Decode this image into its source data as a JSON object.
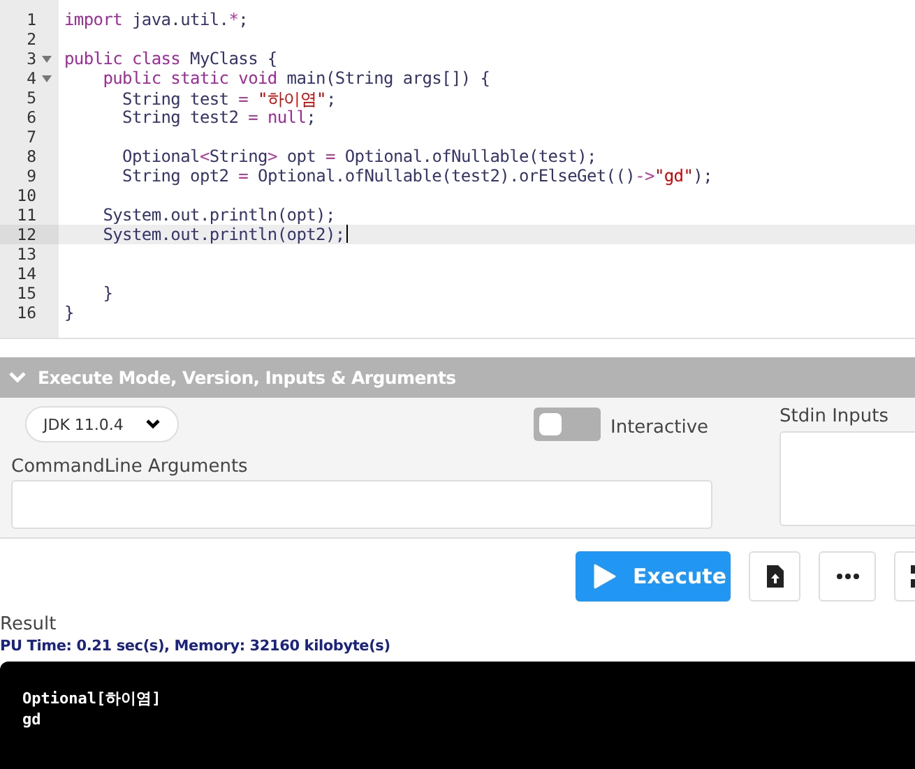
{
  "editor": {
    "lines": [
      {
        "number": "1",
        "foldable": false,
        "active": false,
        "tokens": [
          {
            "text": "import",
            "kind": "keyword"
          },
          {
            "text": " java.util.",
            "kind": "plain"
          },
          {
            "text": "*",
            "kind": "operator"
          },
          {
            "text": ";",
            "kind": "plain"
          }
        ]
      },
      {
        "number": "2",
        "foldable": false,
        "active": false
      },
      {
        "number": "3",
        "foldable": true,
        "active": false,
        "tokens": [
          {
            "text": "public class",
            "kind": "keyword"
          },
          {
            "text": " MyClass {",
            "kind": "plain"
          }
        ]
      },
      {
        "number": "4",
        "foldable": true,
        "active": false,
        "tokens": [
          {
            "text": "    public static void",
            "kind": "keyword"
          },
          {
            "text": " main(String args[]) {",
            "kind": "plain"
          }
        ]
      },
      {
        "number": "5",
        "foldable": false,
        "active": false,
        "tokens": [
          {
            "text": "      String test ",
            "kind": "plain"
          },
          {
            "text": "= ",
            "kind": "operator"
          },
          {
            "text": "\"하이염\"",
            "kind": "string"
          },
          {
            "text": ";",
            "kind": "plain"
          }
        ]
      },
      {
        "number": "6",
        "foldable": false,
        "active": false,
        "tokens": [
          {
            "text": "      String test2 ",
            "kind": "plain"
          },
          {
            "text": "= ",
            "kind": "operator"
          },
          {
            "text": "null",
            "kind": "keyword"
          },
          {
            "text": ";",
            "kind": "plain"
          }
        ]
      },
      {
        "number": "7",
        "foldable": false,
        "active": false
      },
      {
        "number": "8",
        "foldable": false,
        "active": false,
        "tokens": [
          {
            "text": "      Optional",
            "kind": "plain"
          },
          {
            "text": "<",
            "kind": "operator"
          },
          {
            "text": "String",
            "kind": "plain"
          },
          {
            "text": ">",
            "kind": "operator"
          },
          {
            "text": " opt ",
            "kind": "plain"
          },
          {
            "text": "=",
            "kind": "operator"
          },
          {
            "text": " Optional.ofNullable(test);",
            "kind": "plain"
          }
        ]
      },
      {
        "number": "9",
        "foldable": false,
        "active": false,
        "tokens": [
          {
            "text": "      String opt2 ",
            "kind": "plain"
          },
          {
            "text": "=",
            "kind": "operator"
          },
          {
            "text": " Optional.ofNullable(test2).orElseGet(()",
            "kind": "plain"
          },
          {
            "text": "->",
            "kind": "operator"
          },
          {
            "text": "\"gd\"",
            "kind": "string"
          },
          {
            "text": ");",
            "kind": "plain"
          }
        ]
      },
      {
        "number": "10",
        "foldable": false,
        "active": false
      },
      {
        "number": "11",
        "foldable": false,
        "active": false,
        "tokens": [
          {
            "text": "    System.out.println(opt);",
            "kind": "plain"
          }
        ]
      },
      {
        "number": "12",
        "foldable": false,
        "active": true,
        "tokens": [
          {
            "text": "    System.out.println(opt2);",
            "kind": "plain"
          }
        ]
      },
      {
        "number": "13",
        "foldable": false,
        "active": false
      },
      {
        "number": "14",
        "foldable": false,
        "active": false
      },
      {
        "number": "15",
        "foldable": false,
        "active": false,
        "tokens": [
          {
            "text": "    }",
            "kind": "plain"
          }
        ]
      },
      {
        "number": "16",
        "foldable": false,
        "active": false,
        "tokens": [
          {
            "text": "}",
            "kind": "plain"
          }
        ]
      }
    ]
  },
  "settings": {
    "title": "Execute Mode, Version, Inputs & Arguments",
    "expanded": true,
    "version": "JDK 11.0.4",
    "interactive": {
      "label": "Interactive",
      "on": false
    },
    "arguments_label": "CommandLine Arguments",
    "stdin_label": "Stdin Inputs"
  },
  "actions": {
    "execute": "Execute"
  },
  "result": {
    "title": "Result",
    "stats": "PU Time: 0.21 sec(s), Memory: 32160 kilobyte(s)",
    "output": [
      "Optional[하이염]",
      "gd"
    ]
  }
}
